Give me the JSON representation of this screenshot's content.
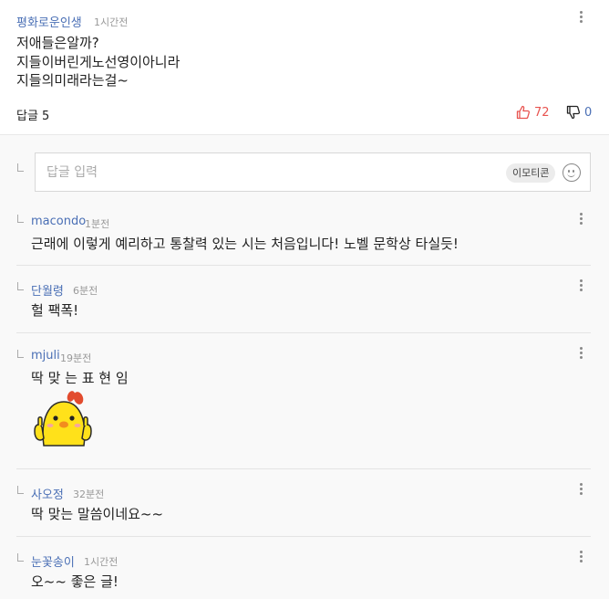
{
  "main_comment": {
    "author": "평화로운인생",
    "time": "1시간전",
    "body": "저애들은알까?\n지들이버린게노선영이아니라\n지들의미래라는걸~",
    "reply_label": "답글 5",
    "likes": "72",
    "dislikes": "0"
  },
  "reply_input": {
    "placeholder": "답글 입력",
    "emoticon_label": "이모티콘"
  },
  "replies": [
    {
      "author": "macondo",
      "time": "1분전",
      "text": "근래에 이렇게 예리하고 통찰력 있는 시는 처음입니다! 노벨 문학상 타실듯!"
    },
    {
      "author": "단월령",
      "time": "6분전",
      "text": "헐 팩폭!"
    },
    {
      "author": "mjuli",
      "time": "19분전",
      "text": "딱 맞 는 표 현 임",
      "sticker": "yellow-chick-thumbs-up"
    },
    {
      "author": "사오정",
      "time": "32분전",
      "text": "딱 맞는 말씀이네요~~"
    },
    {
      "author": "눈꽃송이",
      "time": "1시간전",
      "text": "오~~ 좋은 글!"
    }
  ],
  "colors": {
    "author": "#4a6fb5",
    "like": "#e8534f",
    "dislike": "#4a6fb5",
    "background": "#f9f9f9"
  }
}
